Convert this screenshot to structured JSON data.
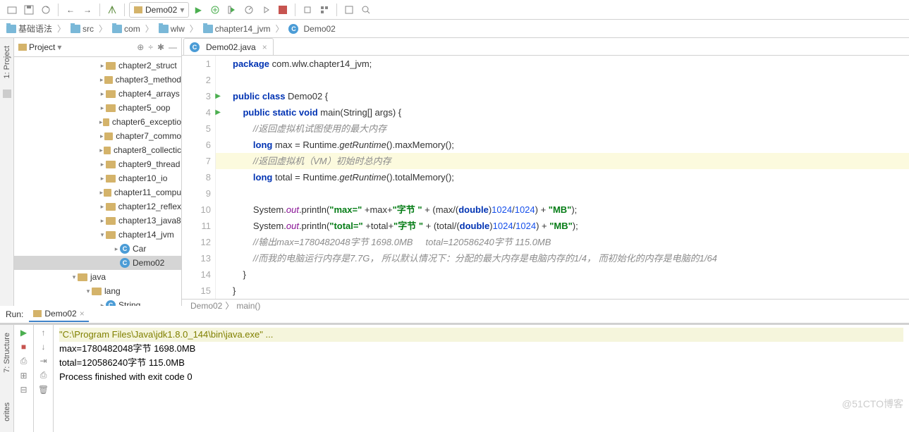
{
  "toolbar": {
    "run_config": "Demo02"
  },
  "breadcrumb": [
    "基础语法",
    "src",
    "com",
    "wlw",
    "chapter14_jvm",
    "Demo02"
  ],
  "project": {
    "title": "Project",
    "tree": [
      {
        "pad": 120,
        "arrow": ">",
        "ico": "folder",
        "label": "chapter2_struct"
      },
      {
        "pad": 120,
        "arrow": ">",
        "ico": "folder",
        "label": "chapter3_method"
      },
      {
        "pad": 120,
        "arrow": ">",
        "ico": "folder",
        "label": "chapter4_arrays"
      },
      {
        "pad": 120,
        "arrow": ">",
        "ico": "folder",
        "label": "chapter5_oop"
      },
      {
        "pad": 120,
        "arrow": ">",
        "ico": "folder",
        "label": "chapter6_exceptio"
      },
      {
        "pad": 120,
        "arrow": ">",
        "ico": "folder",
        "label": "chapter7_commo"
      },
      {
        "pad": 120,
        "arrow": ">",
        "ico": "folder",
        "label": "chapter8_collectic"
      },
      {
        "pad": 120,
        "arrow": ">",
        "ico": "folder",
        "label": "chapter9_thread"
      },
      {
        "pad": 120,
        "arrow": ">",
        "ico": "folder",
        "label": "chapter10_io"
      },
      {
        "pad": 120,
        "arrow": ">",
        "ico": "folder",
        "label": "chapter11_compu"
      },
      {
        "pad": 120,
        "arrow": ">",
        "ico": "folder",
        "label": "chapter12_reflex"
      },
      {
        "pad": 120,
        "arrow": ">",
        "ico": "folder",
        "label": "chapter13_java8"
      },
      {
        "pad": 120,
        "arrow": "v",
        "ico": "folder",
        "label": "chapter14_jvm"
      },
      {
        "pad": 140,
        "arrow": ">",
        "ico": "class",
        "label": "Car"
      },
      {
        "pad": 140,
        "arrow": "",
        "ico": "class",
        "label": "Demo02",
        "sel": true
      },
      {
        "pad": 80,
        "arrow": "v",
        "ico": "folder",
        "label": "java"
      },
      {
        "pad": 100,
        "arrow": "v",
        "ico": "folder",
        "label": "lang"
      },
      {
        "pad": 120,
        "arrow": ">",
        "ico": "class",
        "label": "String"
      }
    ]
  },
  "editor": {
    "tab": "Demo02.java",
    "lines": [
      {
        "n": 1,
        "h": "<span class='kw'>package</span> com.wlw.chapter14_jvm;"
      },
      {
        "n": 2,
        "h": ""
      },
      {
        "n": 3,
        "run": true,
        "h": "<span class='kw'>public class</span> Demo02 {"
      },
      {
        "n": 4,
        "run": true,
        "h": "    <span class='kw'>public static void</span> main(String[] args) {"
      },
      {
        "n": 5,
        "h": "        <span class='cmt'>//返回虚拟机试图使用的最大内存</span>"
      },
      {
        "n": 6,
        "h": "        <span class='kw'>long</span> max = Runtime.<span class='mtd'>getRuntime</span>().maxMemory();"
      },
      {
        "n": 7,
        "hl": true,
        "h": "        <span class='cmt'>//返回虚拟机（VM）初始时总内存</span>"
      },
      {
        "n": 8,
        "h": "        <span class='kw'>long</span> total = Runtime.<span class='mtd'>getRuntime</span>().totalMemory();"
      },
      {
        "n": 9,
        "h": ""
      },
      {
        "n": 10,
        "h": "        System.<span class='fld'>out</span>.println(<span class='str'>\"max=\"</span> +max+<span class='str'>\"字节 \"</span> + (max/(<span class='kw'>double</span>)<span class='num'>1024</span>/<span class='num'>1024</span>) + <span class='str'>\"MB\"</span>);"
      },
      {
        "n": 11,
        "h": "        System.<span class='fld'>out</span>.println(<span class='str'>\"total=\"</span> +total+<span class='str'>\"字节 \"</span> + (total/(<span class='kw'>double</span>)<span class='num'>1024</span>/<span class='num'>1024</span>) + <span class='str'>\"MB\"</span>);"
      },
      {
        "n": 12,
        "h": "        <span class='cmt'>//输出max=1780482048字节 1698.0MB     total=120586240字节 115.0MB</span>"
      },
      {
        "n": 13,
        "h": "        <span class='cmt'>//而我的电脑运行内存是7.7G， 所以默认情况下：分配的最大内存是电脑内存的1/4， 而初始化的内存是电脑的1/64</span>"
      },
      {
        "n": 14,
        "h": "    }"
      },
      {
        "n": 15,
        "h": "}"
      }
    ],
    "crumbs": [
      "Demo02",
      "main()"
    ]
  },
  "run": {
    "label": "Run:",
    "tab": "Demo02",
    "lines": [
      {
        "cls": "cmd",
        "t": "\"C:\\Program Files\\Java\\jdk1.8.0_144\\bin\\java.exe\" ..."
      },
      {
        "cls": "",
        "t": "max=1780482048字节 1698.0MB"
      },
      {
        "cls": "",
        "t": "total=120586240字节 115.0MB"
      },
      {
        "cls": "",
        "t": ""
      },
      {
        "cls": "",
        "t": "Process finished with exit code 0"
      }
    ]
  },
  "watermark": "@51CTO博客"
}
